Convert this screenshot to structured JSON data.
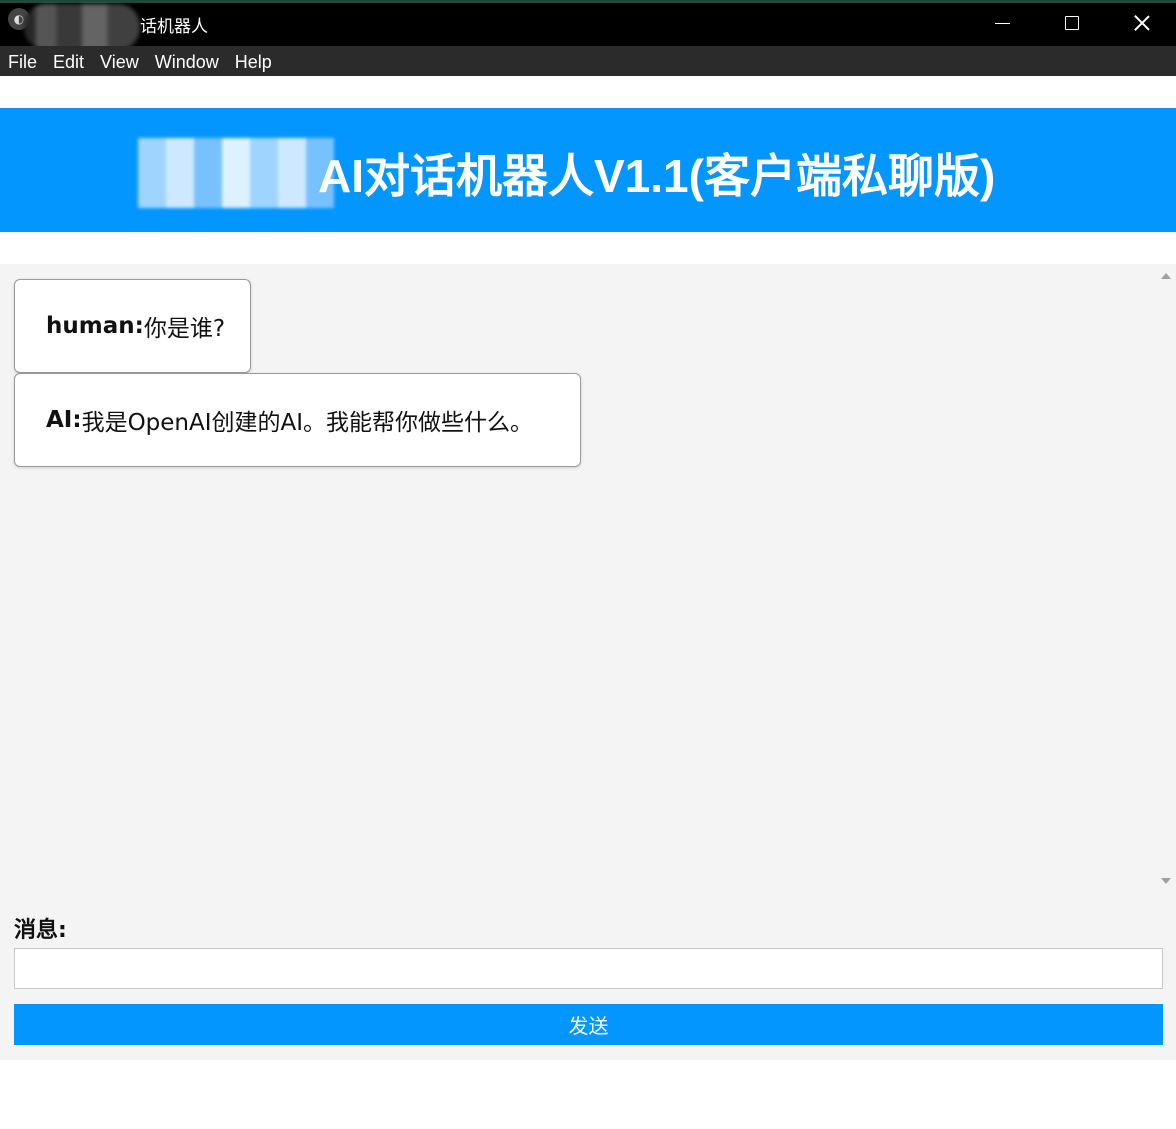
{
  "window": {
    "title": "话机器人",
    "icon_name": "app-icon",
    "controls": [
      "minimize-icon",
      "maximize-icon",
      "close-icon"
    ]
  },
  "menu": {
    "items": [
      "File",
      "Edit",
      "View",
      "Window",
      "Help"
    ]
  },
  "banner": {
    "title": "AI对话机器人V1.1(客户端私聊版)",
    "background": "#0396ff"
  },
  "chat": {
    "messages": [
      {
        "speaker": "human:",
        "text": "你是谁?"
      },
      {
        "speaker": "AI:",
        "text": "我是OpenAI创建的AI。我能帮你做些什么。"
      }
    ]
  },
  "composer": {
    "label": "消息:",
    "input_value": "",
    "send_label": "发送"
  },
  "colors": {
    "accent": "#0396ff",
    "panel": "#f4f4f4",
    "titlebar": "#000000",
    "menubar": "#2b2b2b"
  }
}
